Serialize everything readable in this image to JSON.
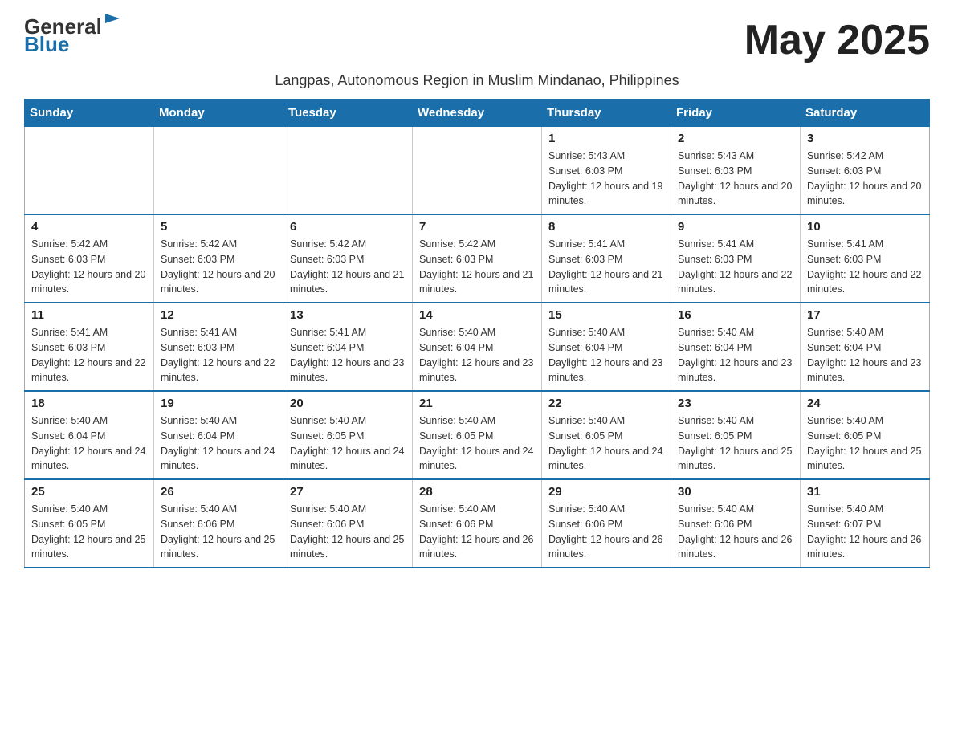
{
  "logo": {
    "general": "General",
    "blue": "Blue"
  },
  "title": "May 2025",
  "subtitle": "Langpas, Autonomous Region in Muslim Mindanao, Philippines",
  "headers": [
    "Sunday",
    "Monday",
    "Tuesday",
    "Wednesday",
    "Thursday",
    "Friday",
    "Saturday"
  ],
  "weeks": [
    [
      {
        "day": "",
        "info": ""
      },
      {
        "day": "",
        "info": ""
      },
      {
        "day": "",
        "info": ""
      },
      {
        "day": "",
        "info": ""
      },
      {
        "day": "1",
        "info": "Sunrise: 5:43 AM\nSunset: 6:03 PM\nDaylight: 12 hours and 19 minutes."
      },
      {
        "day": "2",
        "info": "Sunrise: 5:43 AM\nSunset: 6:03 PM\nDaylight: 12 hours and 20 minutes."
      },
      {
        "day": "3",
        "info": "Sunrise: 5:42 AM\nSunset: 6:03 PM\nDaylight: 12 hours and 20 minutes."
      }
    ],
    [
      {
        "day": "4",
        "info": "Sunrise: 5:42 AM\nSunset: 6:03 PM\nDaylight: 12 hours and 20 minutes."
      },
      {
        "day": "5",
        "info": "Sunrise: 5:42 AM\nSunset: 6:03 PM\nDaylight: 12 hours and 20 minutes."
      },
      {
        "day": "6",
        "info": "Sunrise: 5:42 AM\nSunset: 6:03 PM\nDaylight: 12 hours and 21 minutes."
      },
      {
        "day": "7",
        "info": "Sunrise: 5:42 AM\nSunset: 6:03 PM\nDaylight: 12 hours and 21 minutes."
      },
      {
        "day": "8",
        "info": "Sunrise: 5:41 AM\nSunset: 6:03 PM\nDaylight: 12 hours and 21 minutes."
      },
      {
        "day": "9",
        "info": "Sunrise: 5:41 AM\nSunset: 6:03 PM\nDaylight: 12 hours and 22 minutes."
      },
      {
        "day": "10",
        "info": "Sunrise: 5:41 AM\nSunset: 6:03 PM\nDaylight: 12 hours and 22 minutes."
      }
    ],
    [
      {
        "day": "11",
        "info": "Sunrise: 5:41 AM\nSunset: 6:03 PM\nDaylight: 12 hours and 22 minutes."
      },
      {
        "day": "12",
        "info": "Sunrise: 5:41 AM\nSunset: 6:03 PM\nDaylight: 12 hours and 22 minutes."
      },
      {
        "day": "13",
        "info": "Sunrise: 5:41 AM\nSunset: 6:04 PM\nDaylight: 12 hours and 23 minutes."
      },
      {
        "day": "14",
        "info": "Sunrise: 5:40 AM\nSunset: 6:04 PM\nDaylight: 12 hours and 23 minutes."
      },
      {
        "day": "15",
        "info": "Sunrise: 5:40 AM\nSunset: 6:04 PM\nDaylight: 12 hours and 23 minutes."
      },
      {
        "day": "16",
        "info": "Sunrise: 5:40 AM\nSunset: 6:04 PM\nDaylight: 12 hours and 23 minutes."
      },
      {
        "day": "17",
        "info": "Sunrise: 5:40 AM\nSunset: 6:04 PM\nDaylight: 12 hours and 23 minutes."
      }
    ],
    [
      {
        "day": "18",
        "info": "Sunrise: 5:40 AM\nSunset: 6:04 PM\nDaylight: 12 hours and 24 minutes."
      },
      {
        "day": "19",
        "info": "Sunrise: 5:40 AM\nSunset: 6:04 PM\nDaylight: 12 hours and 24 minutes."
      },
      {
        "day": "20",
        "info": "Sunrise: 5:40 AM\nSunset: 6:05 PM\nDaylight: 12 hours and 24 minutes."
      },
      {
        "day": "21",
        "info": "Sunrise: 5:40 AM\nSunset: 6:05 PM\nDaylight: 12 hours and 24 minutes."
      },
      {
        "day": "22",
        "info": "Sunrise: 5:40 AM\nSunset: 6:05 PM\nDaylight: 12 hours and 24 minutes."
      },
      {
        "day": "23",
        "info": "Sunrise: 5:40 AM\nSunset: 6:05 PM\nDaylight: 12 hours and 25 minutes."
      },
      {
        "day": "24",
        "info": "Sunrise: 5:40 AM\nSunset: 6:05 PM\nDaylight: 12 hours and 25 minutes."
      }
    ],
    [
      {
        "day": "25",
        "info": "Sunrise: 5:40 AM\nSunset: 6:05 PM\nDaylight: 12 hours and 25 minutes."
      },
      {
        "day": "26",
        "info": "Sunrise: 5:40 AM\nSunset: 6:06 PM\nDaylight: 12 hours and 25 minutes."
      },
      {
        "day": "27",
        "info": "Sunrise: 5:40 AM\nSunset: 6:06 PM\nDaylight: 12 hours and 25 minutes."
      },
      {
        "day": "28",
        "info": "Sunrise: 5:40 AM\nSunset: 6:06 PM\nDaylight: 12 hours and 26 minutes."
      },
      {
        "day": "29",
        "info": "Sunrise: 5:40 AM\nSunset: 6:06 PM\nDaylight: 12 hours and 26 minutes."
      },
      {
        "day": "30",
        "info": "Sunrise: 5:40 AM\nSunset: 6:06 PM\nDaylight: 12 hours and 26 minutes."
      },
      {
        "day": "31",
        "info": "Sunrise: 5:40 AM\nSunset: 6:07 PM\nDaylight: 12 hours and 26 minutes."
      }
    ]
  ]
}
